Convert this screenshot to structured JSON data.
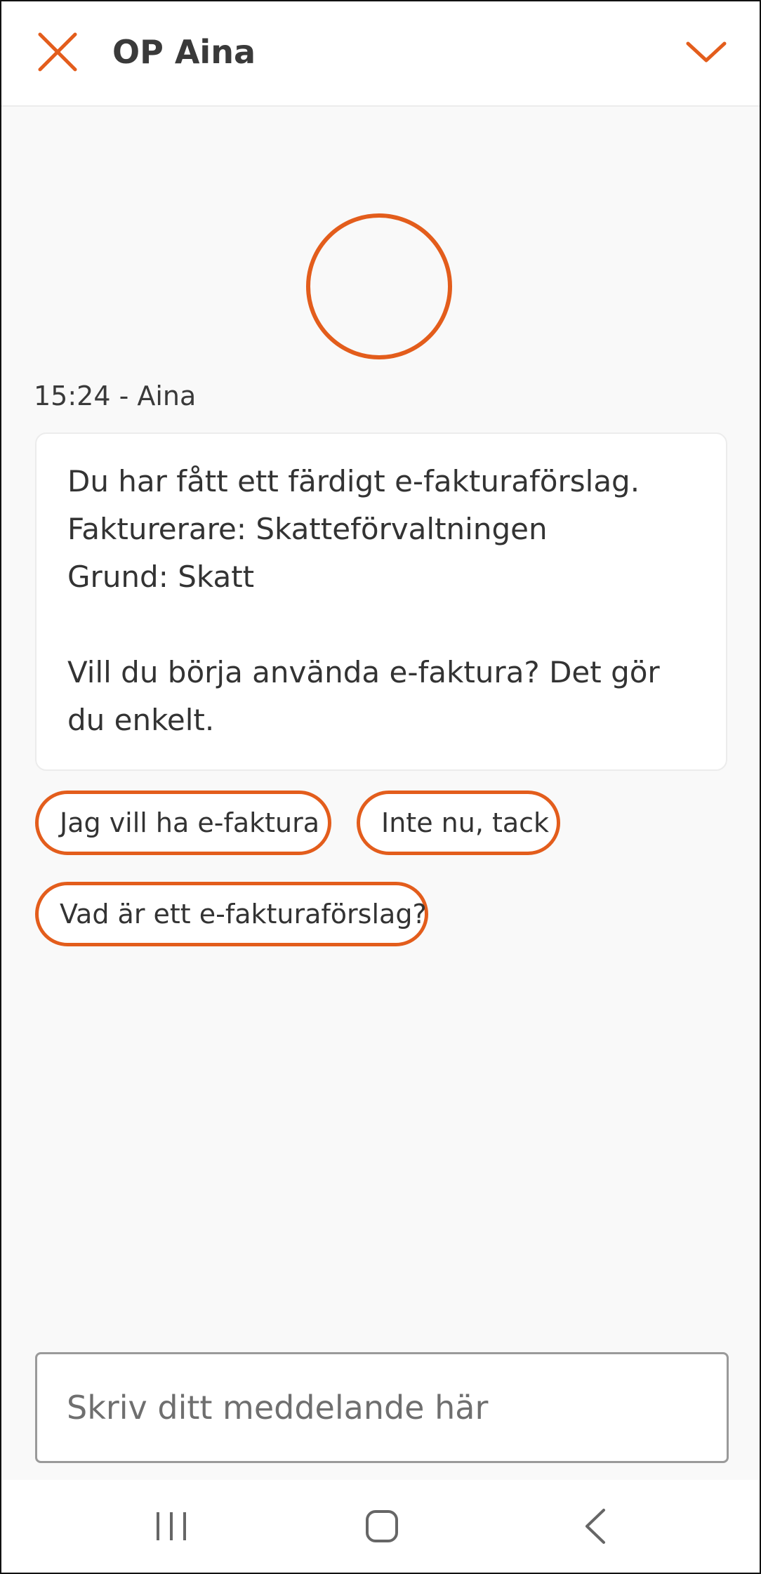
{
  "colors": {
    "accent": "#e35d1c",
    "background": "#f9f9f9",
    "text": "#333333"
  },
  "header": {
    "title": "OP Aina",
    "close_icon": "close-x-icon",
    "collapse_icon": "chevron-down-icon"
  },
  "message": {
    "meta": "15:24 - Aina",
    "lines": [
      "Du har fått ett färdigt e-fakturaförslag.",
      "Fakturerare: Skatteförvaltningen",
      "Grund: Skatt",
      "Vill du börja använda e-faktura? Det gör du enkelt."
    ]
  },
  "quick_replies": [
    "Jag vill ha e-faktura",
    "Inte nu, tack",
    "Vad är ett e-fakturaförslag?"
  ],
  "composer": {
    "placeholder": "Skriv ditt meddelande här",
    "value": ""
  },
  "navbar": {
    "recent_icon": "recent-apps-icon",
    "home_icon": "home-icon",
    "back_icon": "back-icon"
  }
}
